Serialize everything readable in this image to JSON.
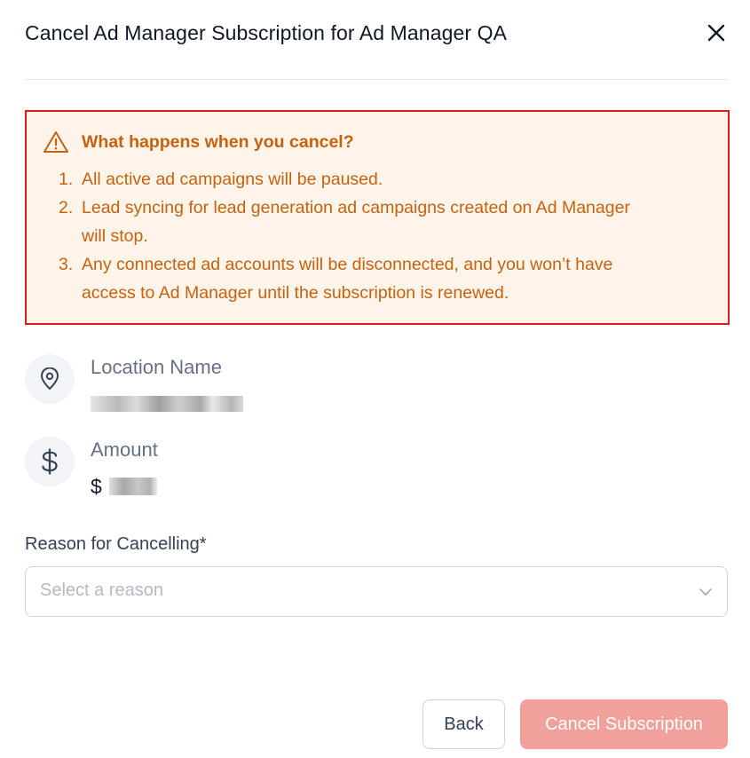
{
  "modal": {
    "title": "Cancel Ad Manager Subscription for Ad Manager QA",
    "close_icon": "close-icon"
  },
  "warning": {
    "icon": "warning-triangle-icon",
    "title": "What happens when you cancel?",
    "items": [
      {
        "num": "1.",
        "text": "All active ad campaigns will be paused."
      },
      {
        "num": "2.",
        "text": "Lead syncing for lead generation ad campaigns created on Ad Manager will stop."
      },
      {
        "num": "3.",
        "text": "Any connected ad accounts will be disconnected, and you won’t have access to Ad Manager until the subscription is renewed."
      }
    ],
    "colors": {
      "text": "#c5620f",
      "background": "#fef4ea",
      "highlight_border": "#d91b1b"
    }
  },
  "location": {
    "icon": "location-pin-icon",
    "label": "Location Name"
  },
  "amount": {
    "icon": "dollar-icon",
    "label": "Amount",
    "currency_symbol": "$"
  },
  "reason": {
    "label": "Reason for Cancelling*",
    "placeholder": "Select a reason",
    "icon": "chevron-down-icon"
  },
  "actions": {
    "back_label": "Back",
    "cancel_label": "Cancel Subscription",
    "cancel_color": "#f0a19b"
  }
}
